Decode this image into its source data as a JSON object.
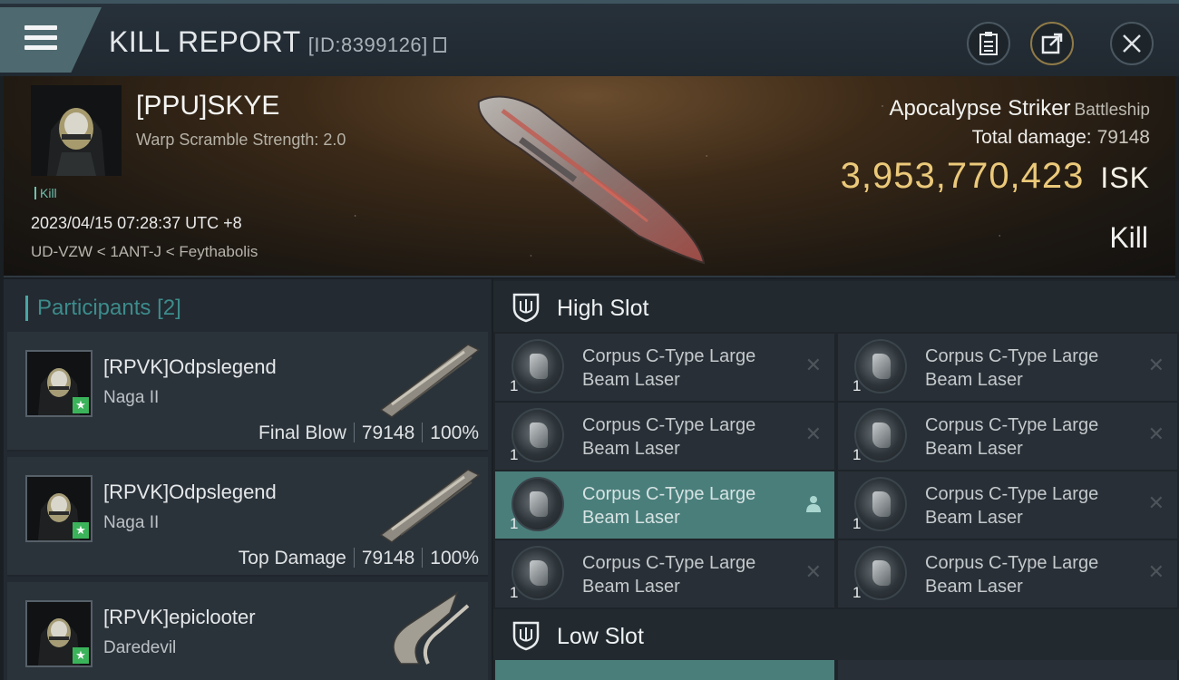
{
  "header": {
    "title": "KILL REPORT",
    "report_id": "[ID:8399126]"
  },
  "victim": {
    "name": "[PPU]SKYE",
    "warp_scramble": "Warp Scramble Strength: 2.0",
    "tag": "Kill",
    "datetime": "2023/04/15 07:28:37 UTC +8",
    "location": "UD-VZW < 1ANT-J < Feythabolis",
    "ship_name": "Apocalypse Striker",
    "ship_class": "Battleship",
    "total_damage_label": "Total damage:",
    "total_damage": "79148",
    "isk_value": "3,953,770,423",
    "isk_unit": "ISK",
    "result": "Kill"
  },
  "participants": {
    "label": "Participants",
    "count": "[2]",
    "rows": [
      {
        "name": "[RPVK]Odpslegend",
        "ship": "Naga II",
        "role": "Final Blow",
        "damage": "79148",
        "percent": "100%"
      },
      {
        "name": "[RPVK]Odpslegend",
        "ship": "Naga II",
        "role": "Top Damage",
        "damage": "79148",
        "percent": "100%"
      },
      {
        "name": "[RPVK]epiclooter",
        "ship": "Daredevil",
        "role": "",
        "damage": "",
        "percent": ""
      }
    ]
  },
  "slots": {
    "high_label": "High Slot",
    "low_label": "Low Slot",
    "high_items": [
      {
        "name": "Corpus C-Type Large Beam Laser",
        "qty": "1",
        "status": "destroyed"
      },
      {
        "name": "Corpus C-Type Large Beam Laser",
        "qty": "1",
        "status": "destroyed"
      },
      {
        "name": "Corpus C-Type Large Beam Laser",
        "qty": "1",
        "status": "destroyed"
      },
      {
        "name": "Corpus C-Type Large Beam Laser",
        "qty": "1",
        "status": "destroyed"
      },
      {
        "name": "Corpus C-Type Large Beam Laser",
        "qty": "1",
        "status": "dropped"
      },
      {
        "name": "Corpus C-Type Large Beam Laser",
        "qty": "1",
        "status": "destroyed"
      },
      {
        "name": "Corpus C-Type Large Beam Laser",
        "qty": "1",
        "status": "destroyed"
      },
      {
        "name": "Corpus C-Type Large Beam Laser",
        "qty": "1",
        "status": "destroyed"
      }
    ]
  },
  "colors": {
    "accent_teal": "#4aa6a6",
    "isk_gold": "#ebc97a",
    "selected_row": "#4a7e7b",
    "star_green": "#3bb35a"
  },
  "icons": [
    "menu-icon",
    "copy-icon",
    "clipboard-icon",
    "share-icon",
    "close-icon",
    "shield-icon",
    "star-icon",
    "x-icon",
    "person-icon"
  ]
}
